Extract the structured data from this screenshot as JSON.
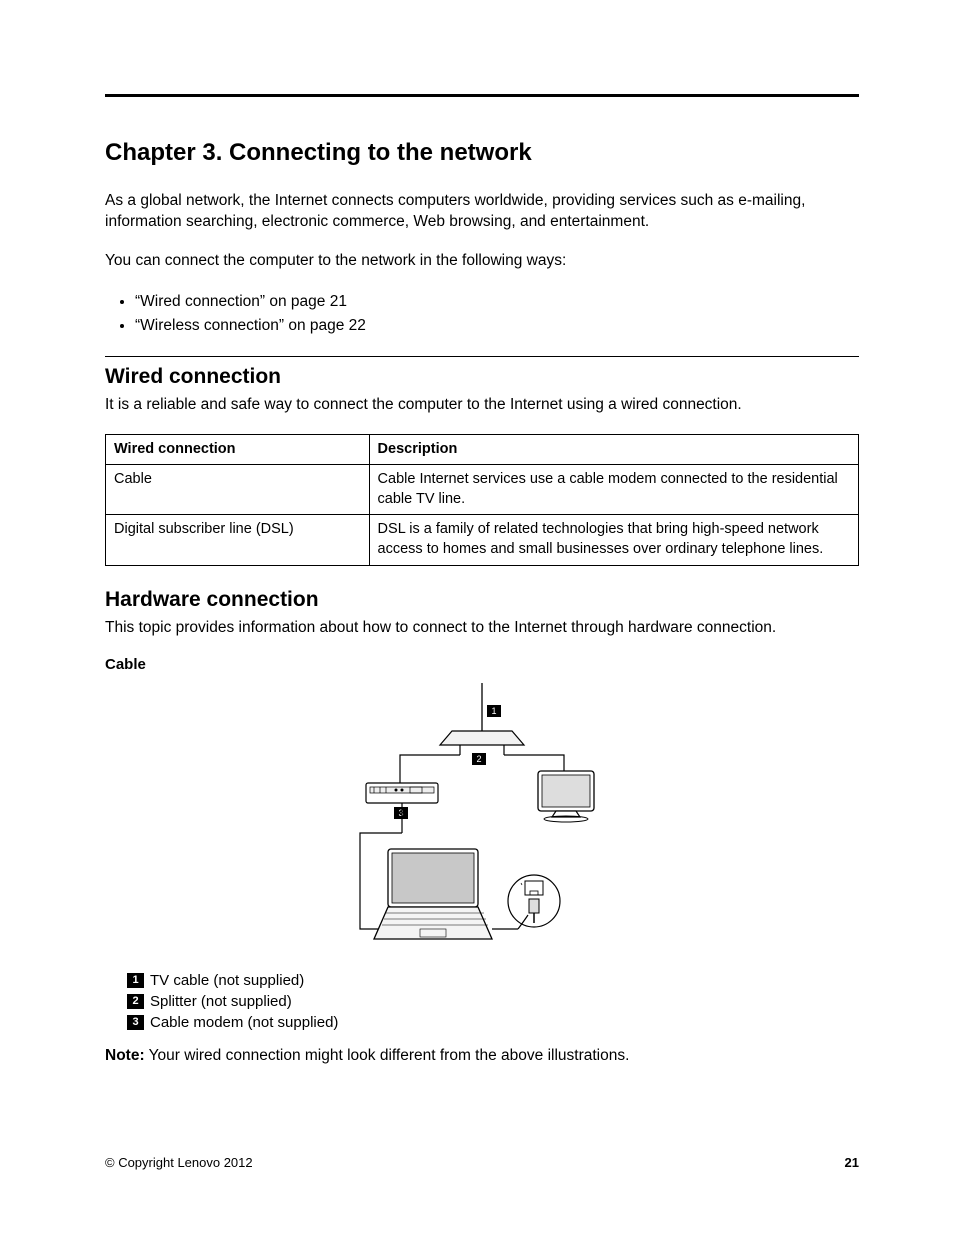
{
  "chapter_title": "Chapter 3.   Connecting to the network",
  "intro_para": "As a global network, the Internet connects computers worldwide, providing services such as e-mailing, information searching, electronic commerce, Web browsing, and entertainment.",
  "ways_para": "You can connect the computer to the network in the following ways:",
  "bullets": {
    "b0": "“Wired connection” on page 21",
    "b1": "“Wireless connection” on page 22"
  },
  "wired": {
    "heading": "Wired connection",
    "intro": "It is a reliable and safe way to connect the computer to the Internet using a wired connection.",
    "th1": "Wired connection",
    "th2": "Description",
    "r1c1": "Cable",
    "r1c2": "Cable Internet services use a cable modem connected to the residential cable TV line.",
    "r2c1": "Digital subscriber line (DSL)",
    "r2c2": "DSL is a family of related technologies that bring high-speed network access to homes and small businesses over ordinary telephone lines."
  },
  "hardware": {
    "heading": "Hardware connection",
    "intro": "This topic provides information about how to connect to the Internet through hardware connection.",
    "cable_label": "Cable",
    "callouts": {
      "c1": "1",
      "c2": "2",
      "c3": "3"
    },
    "legend": {
      "l1": "TV cable (not supplied)",
      "l2": "Splitter (not supplied)",
      "l3": "Cable modem (not supplied)"
    },
    "note_label": "Note:",
    "note_text": " Your wired connection might look different from the above illustrations."
  },
  "footer": {
    "copyright": "© Copyright Lenovo 2012",
    "page": "21"
  }
}
